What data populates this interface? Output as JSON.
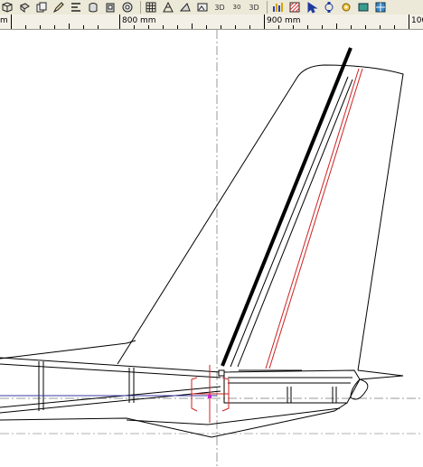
{
  "toolbar": {
    "icons": [
      "cube-icon",
      "rotate-icon",
      "copy-icon",
      "edit-icon",
      "align-icon",
      "layers-icon",
      "stamp-icon",
      "disc-icon",
      "grid-icon",
      "mesh-icon",
      "plane-icon",
      "image-icon",
      "view-3d-icon",
      "angle-icon",
      "render-3d-icon",
      "text-icon",
      "bar-chart-icon",
      "pattern-icon",
      "select-arrow-icon",
      "node-edit-icon",
      "gear-icon",
      "screen-icon",
      "grid-view-icon"
    ],
    "labels": {
      "view3d": "3D",
      "angle": "30",
      "render3d": "3D"
    }
  },
  "ruler": {
    "labels": [
      "m",
      "800 mm",
      "900 mm",
      "100"
    ]
  }
}
